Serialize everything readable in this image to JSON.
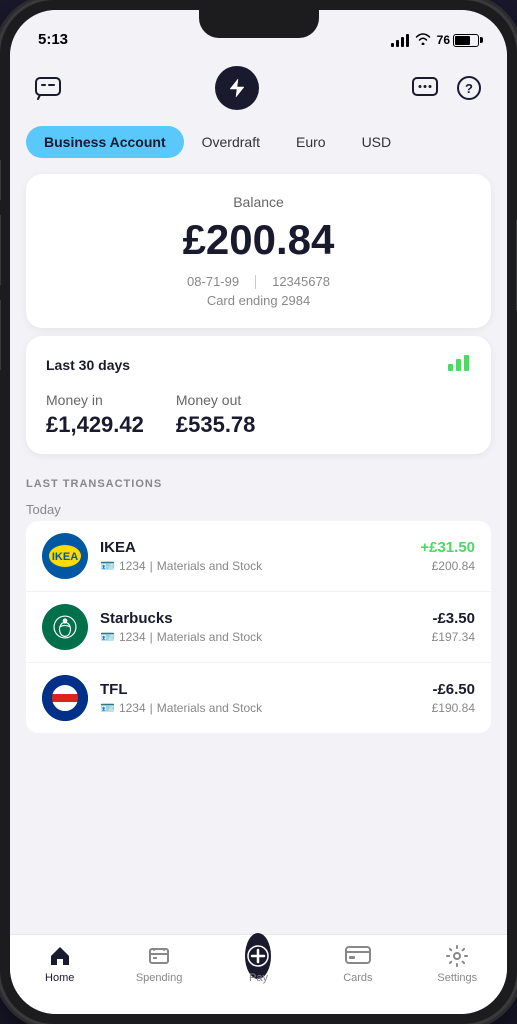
{
  "statusBar": {
    "time": "5:13",
    "batteryLevel": "76"
  },
  "header": {
    "chatIcon": "💬",
    "moreIcon": "⋯",
    "helpIcon": "?"
  },
  "accountTabs": {
    "tabs": [
      {
        "id": "business",
        "label": "Business Account",
        "active": true
      },
      {
        "id": "overdraft",
        "label": "Overdraft",
        "active": false
      },
      {
        "id": "euro",
        "label": "Euro",
        "active": false
      },
      {
        "id": "usd",
        "label": "USD",
        "active": false
      }
    ]
  },
  "balanceCard": {
    "label": "Balance",
    "amount": "£200.84",
    "sortCode": "08-71-99",
    "accountNumber": "12345678",
    "cardEnding": "Card ending 2984"
  },
  "statsCard": {
    "period": "Last 30 days",
    "moneyIn": {
      "label": "Money in",
      "value": "£1,429.42"
    },
    "moneyOut": {
      "label": "Money out",
      "value": "£535.78"
    }
  },
  "transactions": {
    "sectionTitle": "LAST TRANSACTIONS",
    "today": "Today",
    "items": [
      {
        "id": "ikea",
        "name": "IKEA",
        "cardRef": "1234",
        "category": "Materials and Stock",
        "amount": "+£31.50",
        "amountType": "positive",
        "balance": "£200.84"
      },
      {
        "id": "starbucks",
        "name": "Starbucks",
        "cardRef": "1234",
        "category": "Materials and Stock",
        "amount": "-£3.50",
        "amountType": "negative",
        "balance": "£197.34"
      },
      {
        "id": "tfl",
        "name": "TFL",
        "cardRef": "1234",
        "category": "Materials and Stock",
        "amount": "-£6.50",
        "amountType": "negative",
        "balance": "£190.84"
      }
    ]
  },
  "bottomNav": {
    "items": [
      {
        "id": "home",
        "label": "Home",
        "active": true
      },
      {
        "id": "spending",
        "label": "Spending",
        "active": false
      },
      {
        "id": "pay",
        "label": "Pay",
        "active": false
      },
      {
        "id": "cards",
        "label": "Cards",
        "active": false
      },
      {
        "id": "settings",
        "label": "Settings",
        "active": false
      }
    ]
  }
}
